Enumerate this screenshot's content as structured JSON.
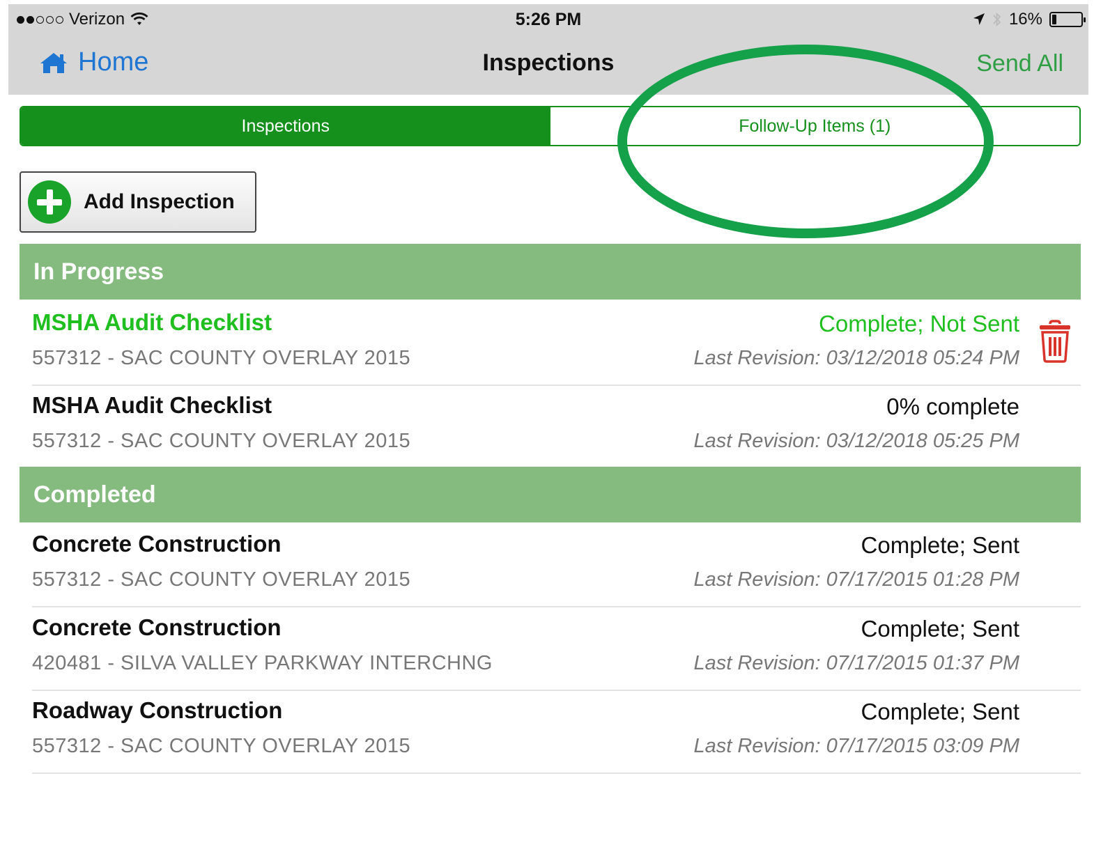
{
  "status_bar": {
    "carrier": "Verizon",
    "time": "5:26 PM",
    "battery_text": "16%",
    "battery_level": 0.16
  },
  "nav": {
    "home_label": "Home",
    "title": "Inspections",
    "send_all_label": "Send All"
  },
  "tabs": [
    {
      "label": "Inspections",
      "active": true
    },
    {
      "label": "Follow-Up Items (1)",
      "active": false
    }
  ],
  "add_button": {
    "label": "Add Inspection"
  },
  "sections": [
    {
      "title": "In Progress",
      "items": [
        {
          "name": "MSHA Audit Checklist",
          "project": "557312 - SAC COUNTY OVERLAY 2015",
          "status": "Complete; Not Sent",
          "revision": "Last Revision: 03/12/2018 05:24 PM",
          "highlight": true
        },
        {
          "name": "MSHA Audit Checklist",
          "project": "557312 - SAC COUNTY OVERLAY 2015",
          "status": "0% complete",
          "revision": "Last Revision: 03/12/2018 05:25 PM",
          "highlight": false
        }
      ]
    },
    {
      "title": "Completed",
      "items": [
        {
          "name": "Concrete Construction",
          "project": "557312 - SAC COUNTY OVERLAY 2015",
          "status": "Complete; Sent",
          "revision": "Last Revision: 07/17/2015 01:28 PM"
        },
        {
          "name": "Concrete Construction",
          "project": "420481 - SILVA VALLEY PARKWAY INTERCHNG",
          "status": "Complete; Sent",
          "revision": "Last Revision: 07/17/2015 01:37 PM"
        },
        {
          "name": "Roadway Construction",
          "project": "557312 - SAC COUNTY OVERLAY 2015",
          "status": "Complete; Sent",
          "revision": "Last Revision: 07/17/2015 03:09 PM"
        }
      ]
    }
  ],
  "colors": {
    "accent_green": "#16901c",
    "section_green": "#86bb80",
    "link_blue": "#1f76d2",
    "delete_red": "#d9342b",
    "annotation_green": "#15a04a"
  }
}
